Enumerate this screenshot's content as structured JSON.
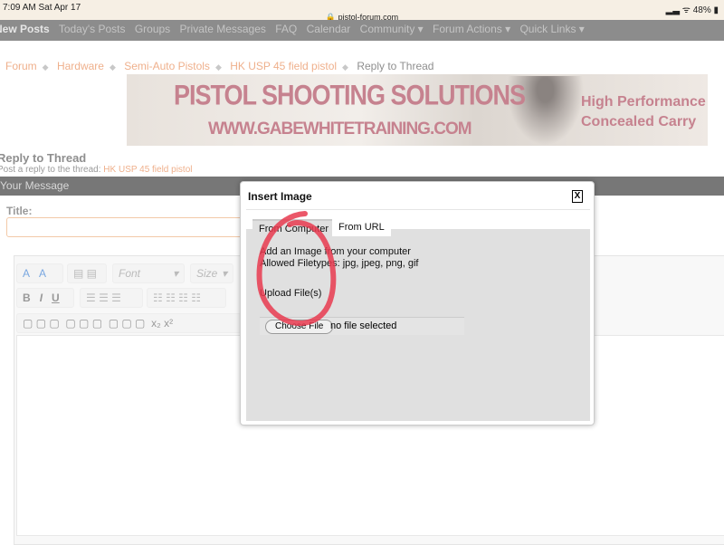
{
  "status_bar": {
    "time": "7:09 AM  Sat Apr 17",
    "url": "pistol-forum.com",
    "battery": "48%"
  },
  "nav": {
    "items": [
      "New Posts",
      "Today's Posts",
      "Groups",
      "Private Messages",
      "FAQ",
      "Calendar",
      "Community ▾",
      "Forum Actions ▾",
      "Quick Links ▾"
    ]
  },
  "breadcrumb": {
    "items": [
      "Forum",
      "Hardware",
      "Semi-Auto Pistols",
      "HK USP 45 field pistol"
    ],
    "current": "Reply to Thread",
    "separator": "◆"
  },
  "banner": {
    "title": "PISTOL SHOOTING SOLUTIONS",
    "url": "WWW.GABEWHITETRAINING.COM",
    "tagline1": "High Performance",
    "tagline2": "Concealed Carry"
  },
  "page": {
    "heading": "Reply to Thread",
    "subtitle": "Post a reply to the thread:",
    "thread_link": "HK USP 45 field pistol",
    "section": "Your Message",
    "title_label": "Title:"
  },
  "editor": {
    "font_placeholder": "Font",
    "size_placeholder": "Size",
    "bold": "B",
    "italic": "I",
    "underline": "U",
    "subscript": "x₂",
    "superscript": "x²"
  },
  "modal": {
    "title": "Insert Image",
    "close": "X",
    "tabs": [
      "From Computer",
      "From URL"
    ],
    "active_tab": "From Computer",
    "line1": "Add an Image from your computer",
    "line2": "Allowed Filetypes: jpg, jpeg, png, gif",
    "choose_button": "Choose File",
    "no_file": "no file selected",
    "upload": "Upload File(s)"
  },
  "annotation_color": "#e8394f"
}
